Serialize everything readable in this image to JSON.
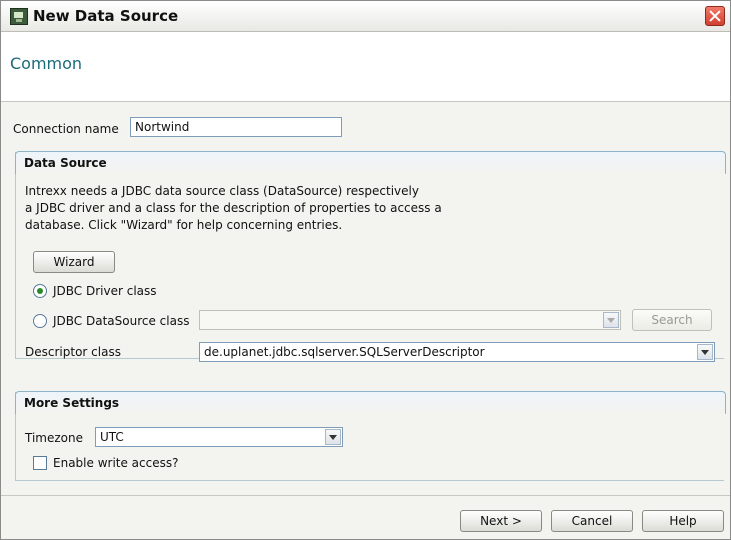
{
  "window": {
    "title": "New Data Source"
  },
  "header": {
    "title": "Common"
  },
  "connection": {
    "label": "Connection name",
    "value": "Nortwind"
  },
  "data_source": {
    "title": "Data Source",
    "description_lines": [
      "Intrexx needs a JDBC data source class (DataSource) respectively",
      "a JDBC driver and a class for the description of properties to access a",
      "database. Click \"Wizard\" for help concerning entries."
    ],
    "wizard_label": "Wizard",
    "driver_label": "JDBC Driver class",
    "driver_selected": true,
    "datasource_label": "JDBC DataSource class",
    "datasource_value": "",
    "search_label": "Search",
    "descriptor_label": "Descriptor class",
    "descriptor_value": "de.uplanet.jdbc.sqlserver.SQLServerDescriptor"
  },
  "more_settings": {
    "title": "More Settings",
    "timezone_label": "Timezone",
    "timezone_value": "UTC",
    "write_access_label": "Enable write access?",
    "write_access_checked": false
  },
  "footer": {
    "next_label": "Next >",
    "cancel_label": "Cancel",
    "help_label": "Help"
  },
  "icons": {
    "app": "data-source-app-icon",
    "close": "close-icon",
    "dropdown": "chevron-down-icon"
  },
  "colors": {
    "accent": "#1c6a7a",
    "close_button": "#d2402f",
    "radio_selected": "#2a8a2a"
  }
}
